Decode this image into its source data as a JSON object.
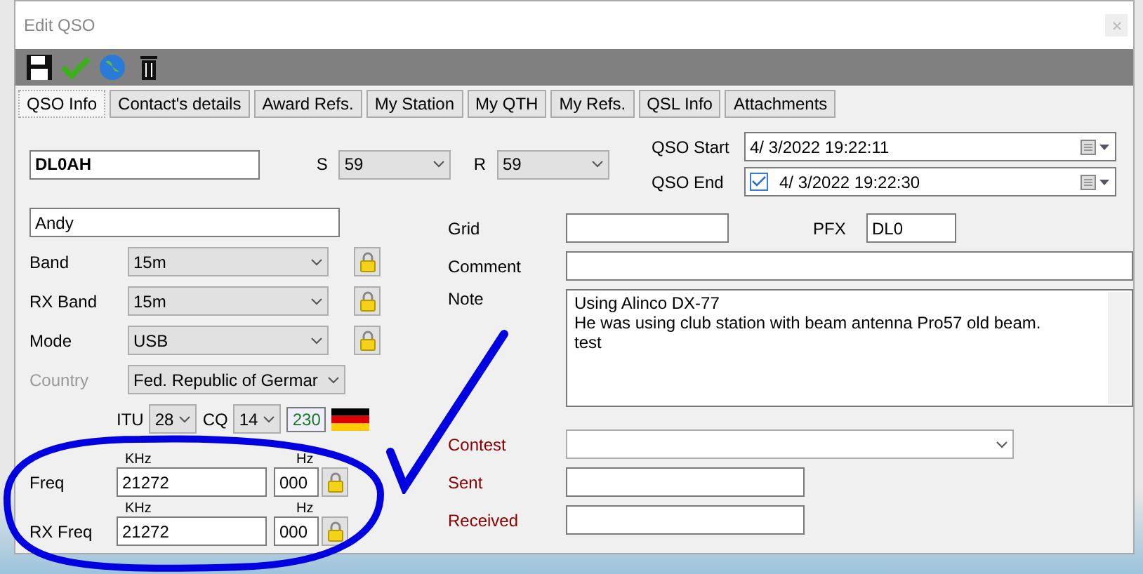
{
  "window": {
    "title": "Edit QSO"
  },
  "tabs": [
    {
      "label": "QSO Info",
      "selected": true
    },
    {
      "label": "Contact's details",
      "selected": false
    },
    {
      "label": "Award Refs.",
      "selected": false
    },
    {
      "label": "My Station",
      "selected": false
    },
    {
      "label": "My QTH",
      "selected": false
    },
    {
      "label": "My Refs.",
      "selected": false
    },
    {
      "label": "QSL Info",
      "selected": false
    },
    {
      "label": "Attachments",
      "selected": false
    }
  ],
  "callsign": "DL0AH",
  "rst": [
    {
      "label": "S",
      "value": "59"
    },
    {
      "label": "R",
      "value": "59"
    }
  ],
  "qso_start": {
    "label": "QSO Start",
    "value": "4/  3/2022 19:22:11"
  },
  "qso_end": {
    "label": "QSO End",
    "value": "4/  3/2022 19:22:30",
    "checked": true
  },
  "name": "Andy",
  "left_fields": [
    {
      "label": "Band",
      "value": "15m",
      "disabled": false
    },
    {
      "label": "RX Band",
      "value": "15m",
      "disabled": false
    },
    {
      "label": "Mode",
      "value": "USB",
      "disabled": false
    }
  ],
  "country": {
    "label": "Country",
    "value": "Fed. Republic of Germar",
    "disabled": true
  },
  "zones": {
    "itu_label": "ITU",
    "itu": "28",
    "cq_label": "CQ",
    "cq": "14",
    "dxcc": "230"
  },
  "frequencies": [
    {
      "label": "Freq",
      "khz_label": "KHz",
      "hz_label": "Hz",
      "khz": "21272",
      "hz": "000"
    },
    {
      "label": "RX Freq",
      "khz_label": "KHz",
      "hz_label": "Hz",
      "khz": "21272",
      "hz": "000"
    }
  ],
  "grid": {
    "label": "Grid"
  },
  "pfx": {
    "label": "PFX",
    "value": "DL0"
  },
  "right_fields": [
    {
      "kind": "text",
      "label": "Comment",
      "highlighted": false
    },
    {
      "kind": "textarea",
      "label": "Note",
      "highlighted": false,
      "lines": [
        "Using Alinco DX-77",
        "He was using club station with beam antenna Pro57 old beam.",
        "test"
      ]
    },
    {
      "kind": "select",
      "label": "Contest",
      "highlighted": true
    },
    {
      "kind": "short",
      "label": "Sent",
      "highlighted": true
    },
    {
      "kind": "short",
      "label": "Received",
      "highlighted": true
    }
  ]
}
